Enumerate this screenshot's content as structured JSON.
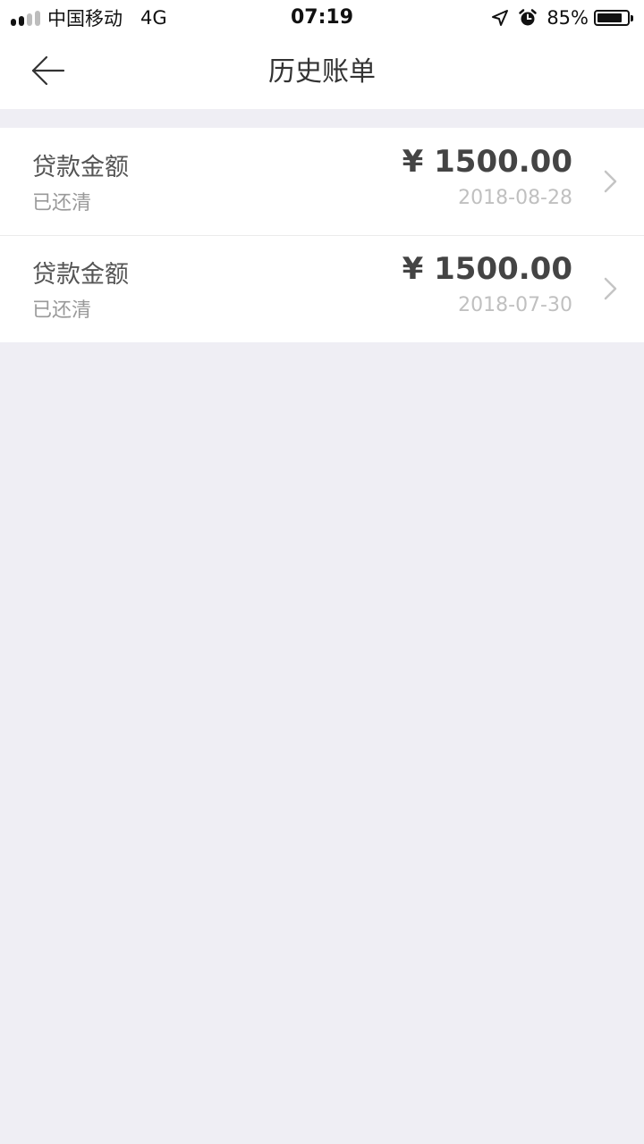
{
  "status_bar": {
    "carrier": "中国移动",
    "network": "4G",
    "time": "07:19",
    "battery_percent": "85%",
    "battery_level": 0.85,
    "signal_bars_filled": 2,
    "signal_bars_total": 4,
    "icons": [
      "location-arrow-icon",
      "alarm-clock-icon",
      "battery-icon"
    ]
  },
  "nav": {
    "title": "历史账单",
    "back_icon": "arrow-left-icon"
  },
  "bills": [
    {
      "label": "贷款金额",
      "status": "已还清",
      "amount": "¥ 1500.00",
      "date": "2018-08-28"
    },
    {
      "label": "贷款金额",
      "status": "已还清",
      "amount": "¥ 1500.00",
      "date": "2018-07-30"
    }
  ],
  "colors": {
    "page_background": "#EFEEF4",
    "card_background": "#FFFFFF",
    "amount_text": "#444444",
    "date_text": "#C0C0C0",
    "status_text": "#999999"
  }
}
